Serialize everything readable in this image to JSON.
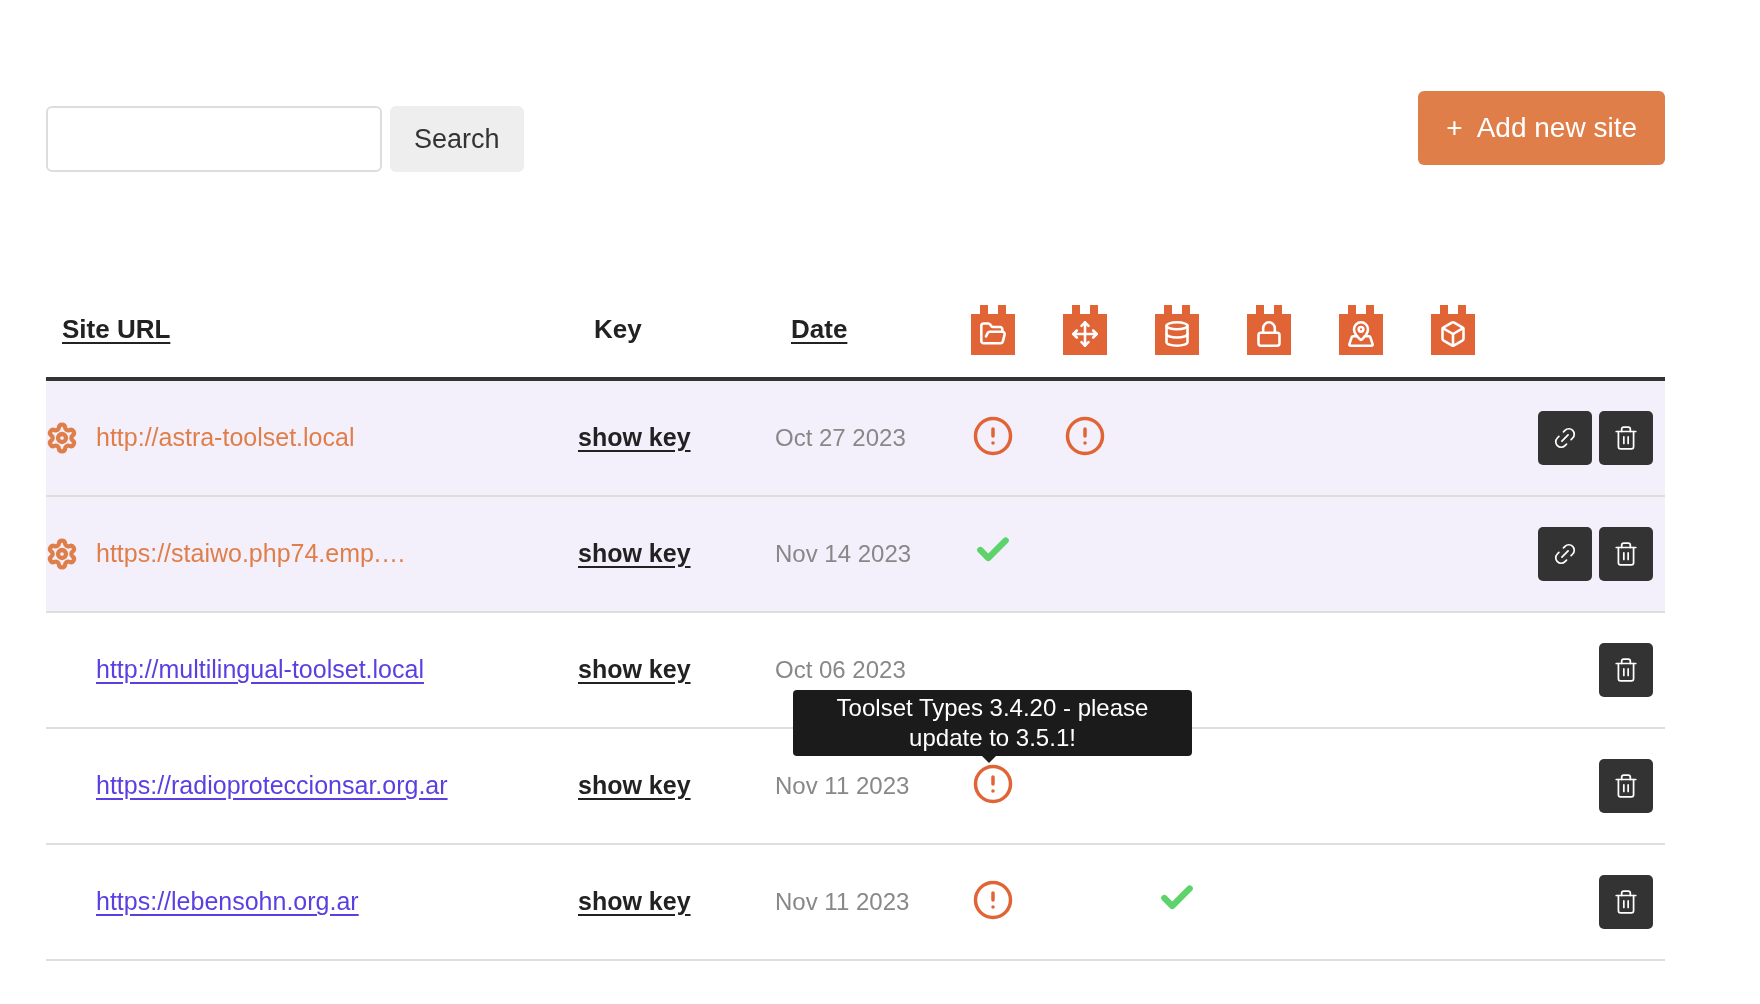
{
  "search": {
    "button": "Search"
  },
  "add_button": {
    "icon": "+",
    "label": "Add new site"
  },
  "table": {
    "columns": [
      {
        "label": "Site URL",
        "sortable": true
      },
      {
        "label": "Key",
        "sortable": false
      },
      {
        "label": "Date",
        "sortable": true
      }
    ],
    "rows": [
      {
        "url": "http://astra-toolset.local",
        "highlighted": true,
        "key": "show key",
        "date": "Oct 27 2023",
        "status": {
          "folder": {
            "kind": "warning"
          },
          "arrows": {
            "kind": "warning"
          }
        }
      },
      {
        "url": "https://staiwo.php74.emp.…",
        "highlighted": true,
        "key": "show key",
        "date": "Nov 14 2023",
        "status": {
          "folder": {
            "kind": "ok"
          }
        }
      },
      {
        "url": "http://multilingual-toolset.local",
        "highlighted": false,
        "key": "show key",
        "date": "Oct 06 2023"
      },
      {
        "url": "https://radioproteccionsar.org.ar",
        "highlighted": false,
        "key": "show key",
        "date": "Nov 11 2023",
        "status": {
          "folder": {
            "kind": "warning"
          }
        }
      },
      {
        "url": "https://lebensohn.org.ar",
        "highlighted": false,
        "key": "show key",
        "date": "Nov 11 2023",
        "status": {
          "folder": {
            "kind": "warning"
          },
          "database": {
            "kind": "ok"
          }
        }
      }
    ]
  },
  "tooltip": {
    "text": "Toolset Types 3.4.20 - please update to 3.5.1!"
  }
}
